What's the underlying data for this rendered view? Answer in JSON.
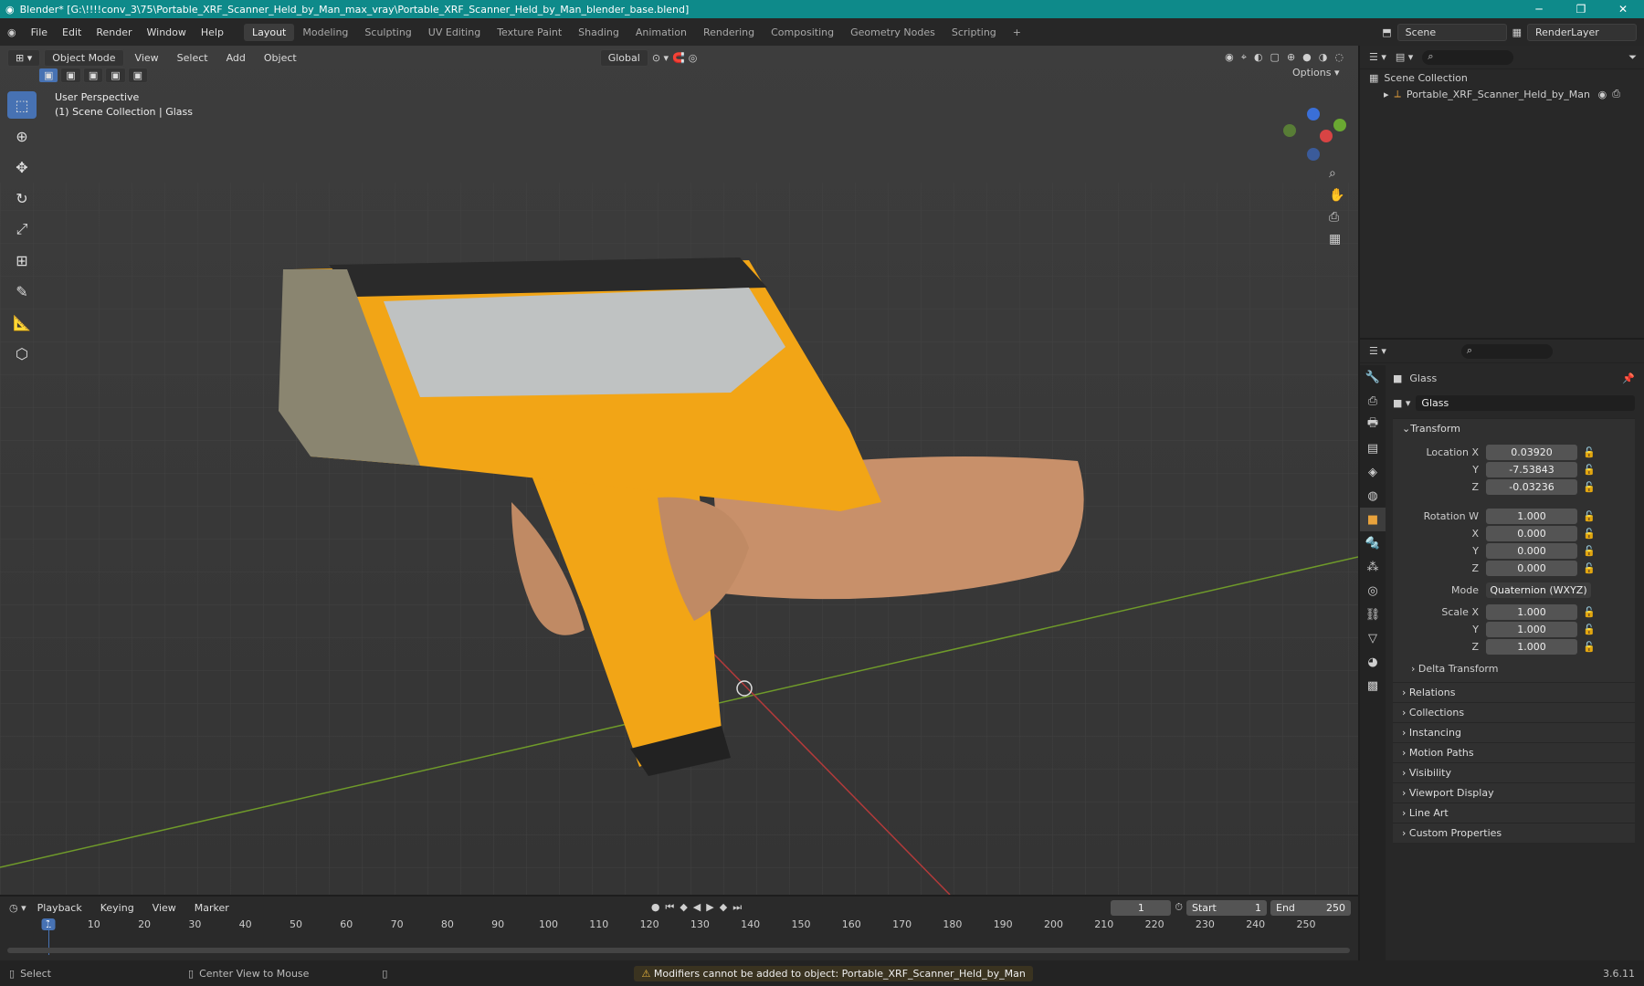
{
  "titlebar": {
    "title": "Blender* [G:\\!!!!conv_3\\75\\Portable_XRF_Scanner_Held_by_Man_max_vray\\Portable_XRF_Scanner_Held_by_Man_blender_base.blend]"
  },
  "menus": [
    "File",
    "Edit",
    "Render",
    "Window",
    "Help"
  ],
  "workspaces": [
    "Layout",
    "Modeling",
    "Sculpting",
    "UV Editing",
    "Texture Paint",
    "Shading",
    "Animation",
    "Rendering",
    "Compositing",
    "Geometry Nodes",
    "Scripting"
  ],
  "scene": {
    "name": "Scene",
    "render_layer": "RenderLayer"
  },
  "viewport": {
    "mode": "Object Mode",
    "menus": [
      "View",
      "Select",
      "Add",
      "Object"
    ],
    "orientation": "Global",
    "options": "Options",
    "perspective": "User Perspective",
    "collection_info": "(1) Scene Collection | Glass"
  },
  "outliner": {
    "root": "Scene Collection",
    "item": "Portable_XRF_Scanner_Held_by_Man"
  },
  "properties": {
    "object_name": "Glass",
    "data_name": "Glass",
    "section": "Transform",
    "location": {
      "label": "Location X",
      "x": "0.03920",
      "y": "-7.53843",
      "z": "-0.03236"
    },
    "rotation": {
      "label": "Rotation W",
      "w": "1.000",
      "x": "0.000",
      "y": "0.000",
      "z": "0.000"
    },
    "mode_label": "Mode",
    "mode": "Quaternion (WXYZ)",
    "scale": {
      "label": "Scale X",
      "x": "1.000",
      "y": "1.000",
      "z": "1.000"
    },
    "axis": {
      "x": "X",
      "y": "Y",
      "z": "Z"
    },
    "delta": "Delta Transform",
    "panels": [
      "Relations",
      "Collections",
      "Instancing",
      "Motion Paths",
      "Visibility",
      "Viewport Display",
      "Line Art",
      "Custom Properties"
    ]
  },
  "timeline": {
    "menus": [
      "Playback",
      "Keying",
      "View",
      "Marker"
    ],
    "current_frame": "1",
    "start_label": "Start",
    "start": "1",
    "end_label": "End",
    "end": "250",
    "ticks": [
      "1",
      "10",
      "20",
      "30",
      "40",
      "50",
      "60",
      "70",
      "80",
      "90",
      "100",
      "110",
      "120",
      "130",
      "140",
      "150",
      "160",
      "170",
      "180",
      "190",
      "200",
      "210",
      "220",
      "230",
      "240",
      "250"
    ]
  },
  "status": {
    "select": "Select",
    "center": "Center View to Mouse",
    "warning": "Modifiers cannot be added to object: Portable_XRF_Scanner_Held_by_Man",
    "version": "3.6.11"
  },
  "colors": {
    "title_bar": "#0e8a8a",
    "accent": "#4772b3",
    "scanner": "#f2a516"
  }
}
